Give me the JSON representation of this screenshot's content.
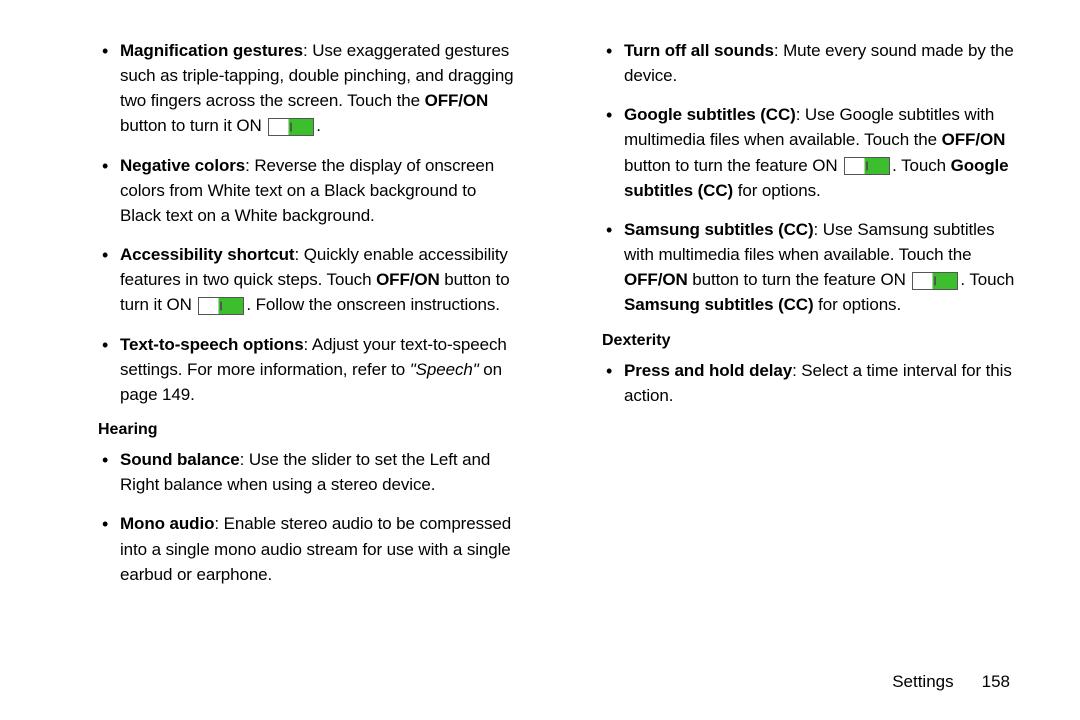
{
  "left": {
    "items": [
      {
        "title": "Magnification gestures",
        "pre": ": Use exaggerated gestures such as triple-tapping, double pinching, and dragging two fingers across the screen. Touch the ",
        "bold1": "OFF/ON",
        "mid": " button to turn it ON ",
        "toggle": true,
        "post": "."
      },
      {
        "title": "Negative colors",
        "text": ": Reverse the display of onscreen colors from White text on a Black background to Black text on a White background."
      },
      {
        "title": "Accessibility shortcut",
        "pre": ": Quickly enable accessibility features in two quick steps. Touch ",
        "bold1": "OFF/ON",
        "mid": " button to turn it ON ",
        "toggle": true,
        "post": ". Follow the onscreen instructions."
      },
      {
        "title": "Text-to-speech options",
        "pre": ": Adjust your text-to-speech settings. For more information, refer to ",
        "ital": "\"Speech\"",
        "post": " on page 149."
      }
    ],
    "heading1": "Hearing",
    "hearing": [
      {
        "title": "Sound balance",
        "text": ": Use the slider to set the Left and Right balance when using a stereo device."
      },
      {
        "title": "Mono audio",
        "text": ": Enable stereo audio to be compressed into a single mono audio stream for use with a single earbud or earphone."
      }
    ]
  },
  "right": {
    "items": [
      {
        "title": "Turn off all sounds",
        "text": ": Mute every sound made by the device."
      },
      {
        "title": "Google subtitles (CC)",
        "pre": ": Use Google subtitles with multimedia files when available. Touch the ",
        "bold1": "OFF/ON",
        "mid": " button to turn the feature ON ",
        "toggle": true,
        "post1": ". Touch ",
        "bold2": "Google subtitles (CC)",
        "post2": " for options."
      },
      {
        "title": "Samsung subtitles (CC)",
        "pre": ": Use Samsung subtitles with multimedia files when available. Touch the ",
        "bold1": "OFF/ON",
        "mid": " button to turn the feature ON ",
        "toggle": true,
        "post1": ". Touch ",
        "bold2": "Samsung subtitles (CC)",
        "post2": " for options."
      }
    ],
    "heading1": "Dexterity",
    "dexterity": [
      {
        "title": "Press and hold delay",
        "text": ": Select a time interval for this action."
      }
    ]
  },
  "footer": {
    "label": "Settings",
    "page": "158"
  }
}
